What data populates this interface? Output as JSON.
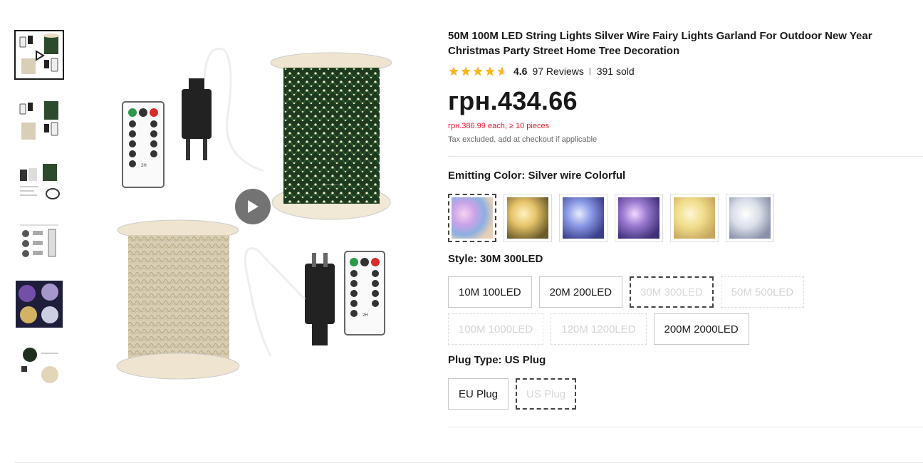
{
  "product": {
    "title": "50M 100M LED String Lights Silver Wire Fairy Lights Garland For Outdoor New Year Christmas Party Street Home Tree Decoration",
    "rating": "4.6",
    "reviews": "97 Reviews",
    "separator": "|",
    "sold": "391 sold",
    "stars_filled": 4.6,
    "price": "грн.434.66",
    "bulk_price": "грн.386.99 each, ≥ 10 pieces",
    "tax_note": "Tax excluded, add at checkout if applicable"
  },
  "icons": {
    "play": "play-icon",
    "star": "star-icon"
  },
  "colors": {
    "star": "#fcb61e",
    "bulk_price": "#e0192f",
    "text": "#191919"
  },
  "emitting_color": {
    "label": "Emitting Color: Silver wire Colorful",
    "swatches": [
      {
        "name": "Silver wire Colorful",
        "selected": true
      },
      {
        "name": "Warm white",
        "selected": false
      },
      {
        "name": "Colorful blue",
        "selected": false
      },
      {
        "name": "Colorful purple",
        "selected": false
      },
      {
        "name": "Warm white silver",
        "selected": false
      },
      {
        "name": "Cool white",
        "selected": false
      }
    ]
  },
  "style": {
    "label": "Style: 30M 300LED",
    "options": [
      {
        "label": "10M 100LED",
        "state": "available"
      },
      {
        "label": "20M 200LED",
        "state": "available"
      },
      {
        "label": "30M 300LED",
        "state": "selected-unavailable"
      },
      {
        "label": "50M 500LED",
        "state": "unavailable"
      },
      {
        "label": "100M 1000LED",
        "state": "unavailable"
      },
      {
        "label": "120M 1200LED",
        "state": "unavailable"
      },
      {
        "label": "200M 2000LED",
        "state": "available"
      }
    ]
  },
  "plug_type": {
    "label": "Plug Type: US Plug",
    "options": [
      {
        "label": "EU Plug",
        "state": "available"
      },
      {
        "label": "US Plug",
        "state": "selected-unavailable"
      }
    ]
  }
}
